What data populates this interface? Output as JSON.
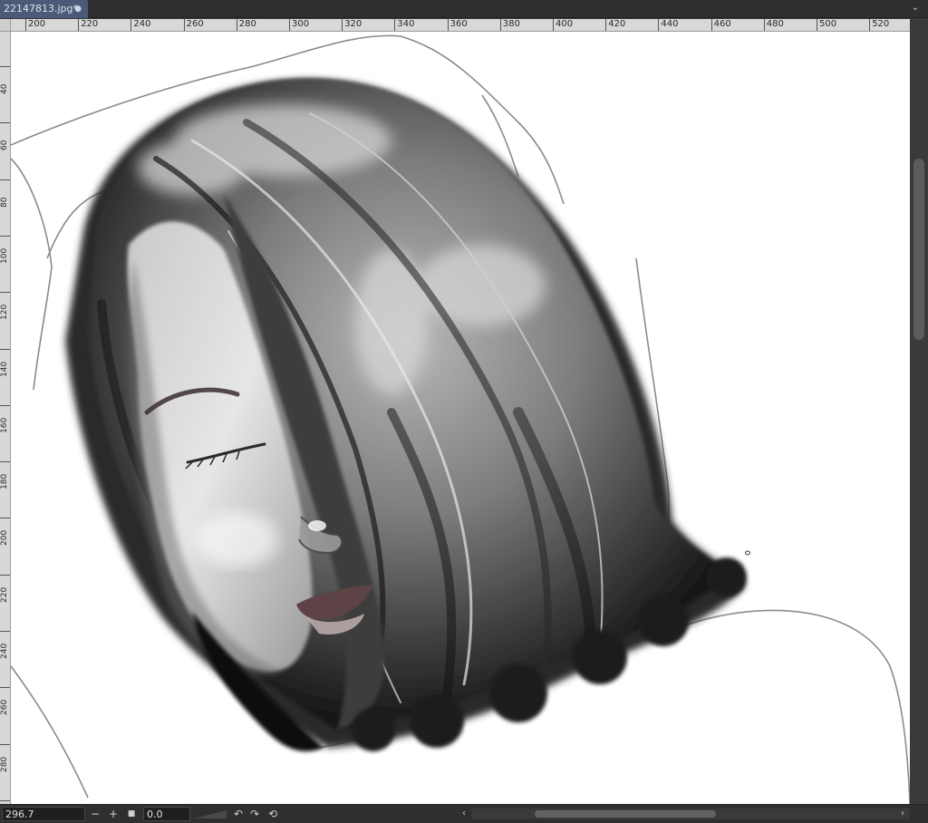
{
  "document_tab": {
    "title": "22147813.jpg*",
    "close_symbol": "●"
  },
  "tab_menu_icon": "chevron-down-icon",
  "ruler_top": {
    "ticks": [
      "200",
      "220",
      "240",
      "260",
      "280",
      "300",
      "320",
      "340",
      "360",
      "380",
      "400",
      "420",
      "440",
      "460",
      "480",
      "500",
      "520"
    ]
  },
  "ruler_left": {
    "ticks": [
      "40",
      "60",
      "80",
      "100",
      "120",
      "140",
      "160",
      "180",
      "200",
      "220",
      "240",
      "260",
      "280",
      "300"
    ]
  },
  "statusbar": {
    "zoom_value": "296.7",
    "zoom_out_symbol": "−",
    "zoom_in_symbol": "+",
    "fit_symbol": "■",
    "angle_value": "0.0",
    "rotate_left_symbol": "↶",
    "rotate_right_symbol": "↷",
    "reset_rotate_symbol": "⟲"
  },
  "canvas": {
    "background_color": "#ffffff",
    "subject": "painted-sleeping-woman"
  }
}
